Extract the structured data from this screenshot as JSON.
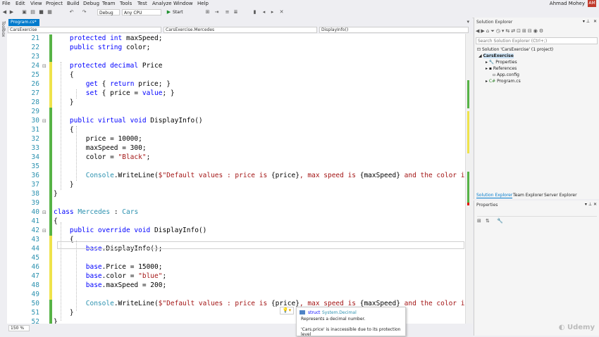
{
  "menu": [
    "File",
    "Edit",
    "View",
    "Project",
    "Build",
    "Debug",
    "Team",
    "Tools",
    "Test",
    "Analyze",
    "Window",
    "Help"
  ],
  "user": {
    "name": "Ahmad Mohey",
    "initials": "AM"
  },
  "toolbar": {
    "config": "Debug",
    "platform": "Any CPU",
    "start_label": "Start"
  },
  "toolbox_label": "Toolbox",
  "tabs": [
    {
      "label": "Program.cs*"
    }
  ],
  "navbar": {
    "project": "CarsExercise",
    "class": "CarsExercise.Mercedes",
    "member": "DisplayInfo()"
  },
  "code_lines": [
    {
      "n": "21",
      "html": "    <span class=\"kw\">protected int</span> maxSpeed;"
    },
    {
      "n": "22",
      "html": "    <span class=\"kw\">public string</span> color;"
    },
    {
      "n": "23",
      "html": ""
    },
    {
      "n": "24",
      "html": "    <span class=\"kw\">protected decimal</span> Price"
    },
    {
      "n": "25",
      "html": "    {"
    },
    {
      "n": "26",
      "html": "        <span class=\"kw\">get</span> { <span class=\"kw\">return</span> price; }"
    },
    {
      "n": "27",
      "html": "        <span class=\"kw\">set</span> { price = <span class=\"kw\">value</span>; }"
    },
    {
      "n": "28",
      "html": "    }"
    },
    {
      "n": "29",
      "html": ""
    },
    {
      "n": "30",
      "html": "    <span class=\"kw\">public virtual void</span> DisplayInfo()"
    },
    {
      "n": "31",
      "html": "    {"
    },
    {
      "n": "32",
      "html": "        price = 10000;"
    },
    {
      "n": "33",
      "html": "        maxSpeed = 300;"
    },
    {
      "n": "34",
      "html": "        color = <span class=\"st\">\"Black\"</span>;"
    },
    {
      "n": "35",
      "html": ""
    },
    {
      "n": "36",
      "html": "        <span class=\"ty\">Console</span>.WriteLine(<span class=\"st\">$\"Default values : price is </span>{price}<span class=\"st\">, max speed is </span>{maxSpeed}<span class=\"st\"> and the color i</span>"
    },
    {
      "n": "37",
      "html": "    }"
    },
    {
      "n": "38",
      "html": "}"
    },
    {
      "n": "39",
      "html": ""
    },
    {
      "n": "40",
      "html": "<span class=\"kw\">class</span> <span class=\"ty\">Mercedes</span> : <span class=\"ty\">Cars</span>"
    },
    {
      "n": "41",
      "html": "{"
    },
    {
      "n": "42",
      "html": "    <span class=\"kw\">public override void</span> DisplayInfo()"
    },
    {
      "n": "43",
      "html": "    {"
    },
    {
      "n": "44",
      "html": "        <span class=\"kw\">base</span>.DisplayInfo();"
    },
    {
      "n": "45",
      "html": ""
    },
    {
      "n": "46",
      "html": "        <span class=\"kw\">base</span>.Price = 15000;"
    },
    {
      "n": "47",
      "html": "        <span class=\"kw\">base</span>.color = <span class=\"st\">\"blue\"</span>;"
    },
    {
      "n": "48",
      "html": "        <span class=\"kw\">base</span>.maxSpeed = 200;"
    },
    {
      "n": "49",
      "html": ""
    },
    {
      "n": "50",
      "html": "        <span class=\"ty\">Console</span>.WriteLine(<span class=\"st\">$\"Default values : price is </span>{price}<span class=\"st\">, max speed is </span>{maxSpeed}<span class=\"st\"> and the color i</span>"
    },
    {
      "n": "51",
      "html": "    }"
    },
    {
      "n": "52",
      "html": "}"
    }
  ],
  "change_marks": [
    "green",
    "green",
    "green",
    "yellow",
    "yellow",
    "yellow",
    "yellow",
    "yellow",
    "green",
    "green",
    "green",
    "green",
    "green",
    "green",
    "green",
    "green",
    "green",
    "green",
    "green",
    "green",
    "green",
    "green",
    "yellow",
    "yellow",
    "yellow",
    "yellow",
    "yellow",
    "yellow",
    "yellow",
    "green",
    "green",
    "green"
  ],
  "colors": {
    "accent": "#007acc",
    "keyword": "#0000ff",
    "type": "#2b91af",
    "string": "#a31515",
    "change_green": "#57b346",
    "change_yellow": "#efe34b"
  },
  "zoom": "150 %",
  "tooltip": {
    "kind": "struct",
    "type": "System.Decimal",
    "desc": "Represents a decimal number.",
    "error": "'Cars.price' is inaccessible due to its protection level"
  },
  "solution_explorer": {
    "title": "Solution Explorer",
    "search_placeholder": "Search Solution Explorer (Ctrl+;)",
    "solution": "Solution 'CarsExercise' (1 project)",
    "project": "CarsExercise",
    "items": [
      "Properties",
      "References",
      "App.config",
      "Program.cs"
    ],
    "bottom_tabs": [
      "Solution Explorer",
      "Team Explorer",
      "Server Explorer"
    ]
  },
  "properties": {
    "title": "Properties"
  },
  "watermark": "Udemy"
}
